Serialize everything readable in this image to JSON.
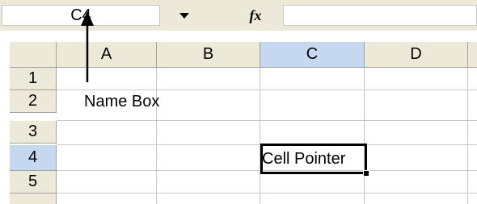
{
  "formula_bar": {
    "name_box_value": "C4",
    "dropdown_icon": "triangle-down",
    "fx_label": "fx",
    "formula_value": ""
  },
  "grid": {
    "columns": [
      "A",
      "B",
      "C",
      "D"
    ],
    "rows": [
      "1",
      "2",
      "3",
      "4",
      "5"
    ],
    "selected_column": "C",
    "selected_row": "4",
    "active_cell_text": "Cell Pointer"
  },
  "annotations": {
    "name_box_label": "Name Box"
  },
  "colors": {
    "header_bg": "#ece9d8",
    "selected_header_bg": "#c6d7f0",
    "gridline": "#c8c8c8"
  }
}
